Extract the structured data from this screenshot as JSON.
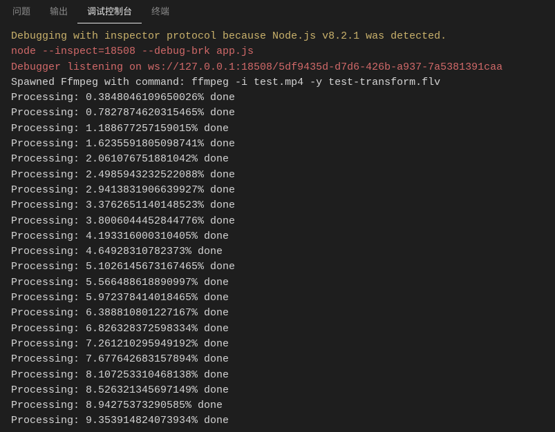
{
  "tabs": [
    {
      "id": "problems",
      "label": "问题",
      "active": false
    },
    {
      "id": "output",
      "label": "输出",
      "active": false
    },
    {
      "id": "debug-console",
      "label": "调试控制台",
      "active": true
    },
    {
      "id": "terminal",
      "label": "终端",
      "active": false
    }
  ],
  "console_lines": [
    {
      "text": "Debugging with inspector protocol because Node.js v8.2.1 was detected.",
      "cls": "ln-yellow"
    },
    {
      "text": "node --inspect=18508 --debug-brk app.js",
      "cls": "ln-red"
    },
    {
      "text": "Debugger listening on ws://127.0.0.1:18508/5df9435d-d7d6-426b-a937-7a5381391caa",
      "cls": "ln-red"
    },
    {
      "text": "Spawned Ffmpeg with command: ffmpeg -i test.mp4 -y test-transform.flv",
      "cls": "ln-default"
    },
    {
      "text": "Processing: 0.3848046109650026% done",
      "cls": "ln-default"
    },
    {
      "text": "Processing: 0.7827874620315465% done",
      "cls": "ln-default"
    },
    {
      "text": "Processing: 1.188677257159015% done",
      "cls": "ln-default"
    },
    {
      "text": "Processing: 1.6235591805098741% done",
      "cls": "ln-default"
    },
    {
      "text": "Processing: 2.061076751881042% done",
      "cls": "ln-default"
    },
    {
      "text": "Processing: 2.4985943232522088% done",
      "cls": "ln-default"
    },
    {
      "text": "Processing: 2.9413831906639927% done",
      "cls": "ln-default"
    },
    {
      "text": "Processing: 3.3762651140148523% done",
      "cls": "ln-default"
    },
    {
      "text": "Processing: 3.8006044452844776% done",
      "cls": "ln-default"
    },
    {
      "text": "Processing: 4.193316000310405% done",
      "cls": "ln-default"
    },
    {
      "text": "Processing: 4.64928310782373% done",
      "cls": "ln-default"
    },
    {
      "text": "Processing: 5.1026145673167465% done",
      "cls": "ln-default"
    },
    {
      "text": "Processing: 5.566488618890997% done",
      "cls": "ln-default"
    },
    {
      "text": "Processing: 5.972378414018465% done",
      "cls": "ln-default"
    },
    {
      "text": "Processing: 6.388810801227167% done",
      "cls": "ln-default"
    },
    {
      "text": "Processing: 6.826328372598334% done",
      "cls": "ln-default"
    },
    {
      "text": "Processing: 7.261210295949192% done",
      "cls": "ln-default"
    },
    {
      "text": "Processing: 7.677642683157894% done",
      "cls": "ln-default"
    },
    {
      "text": "Processing: 8.107253310468138% done",
      "cls": "ln-default"
    },
    {
      "text": "Processing: 8.526321345697149% done",
      "cls": "ln-default"
    },
    {
      "text": "Processing: 8.94275373290585% done",
      "cls": "ln-default"
    },
    {
      "text": "Processing: 9.353914824073934% done",
      "cls": "ln-default"
    }
  ]
}
